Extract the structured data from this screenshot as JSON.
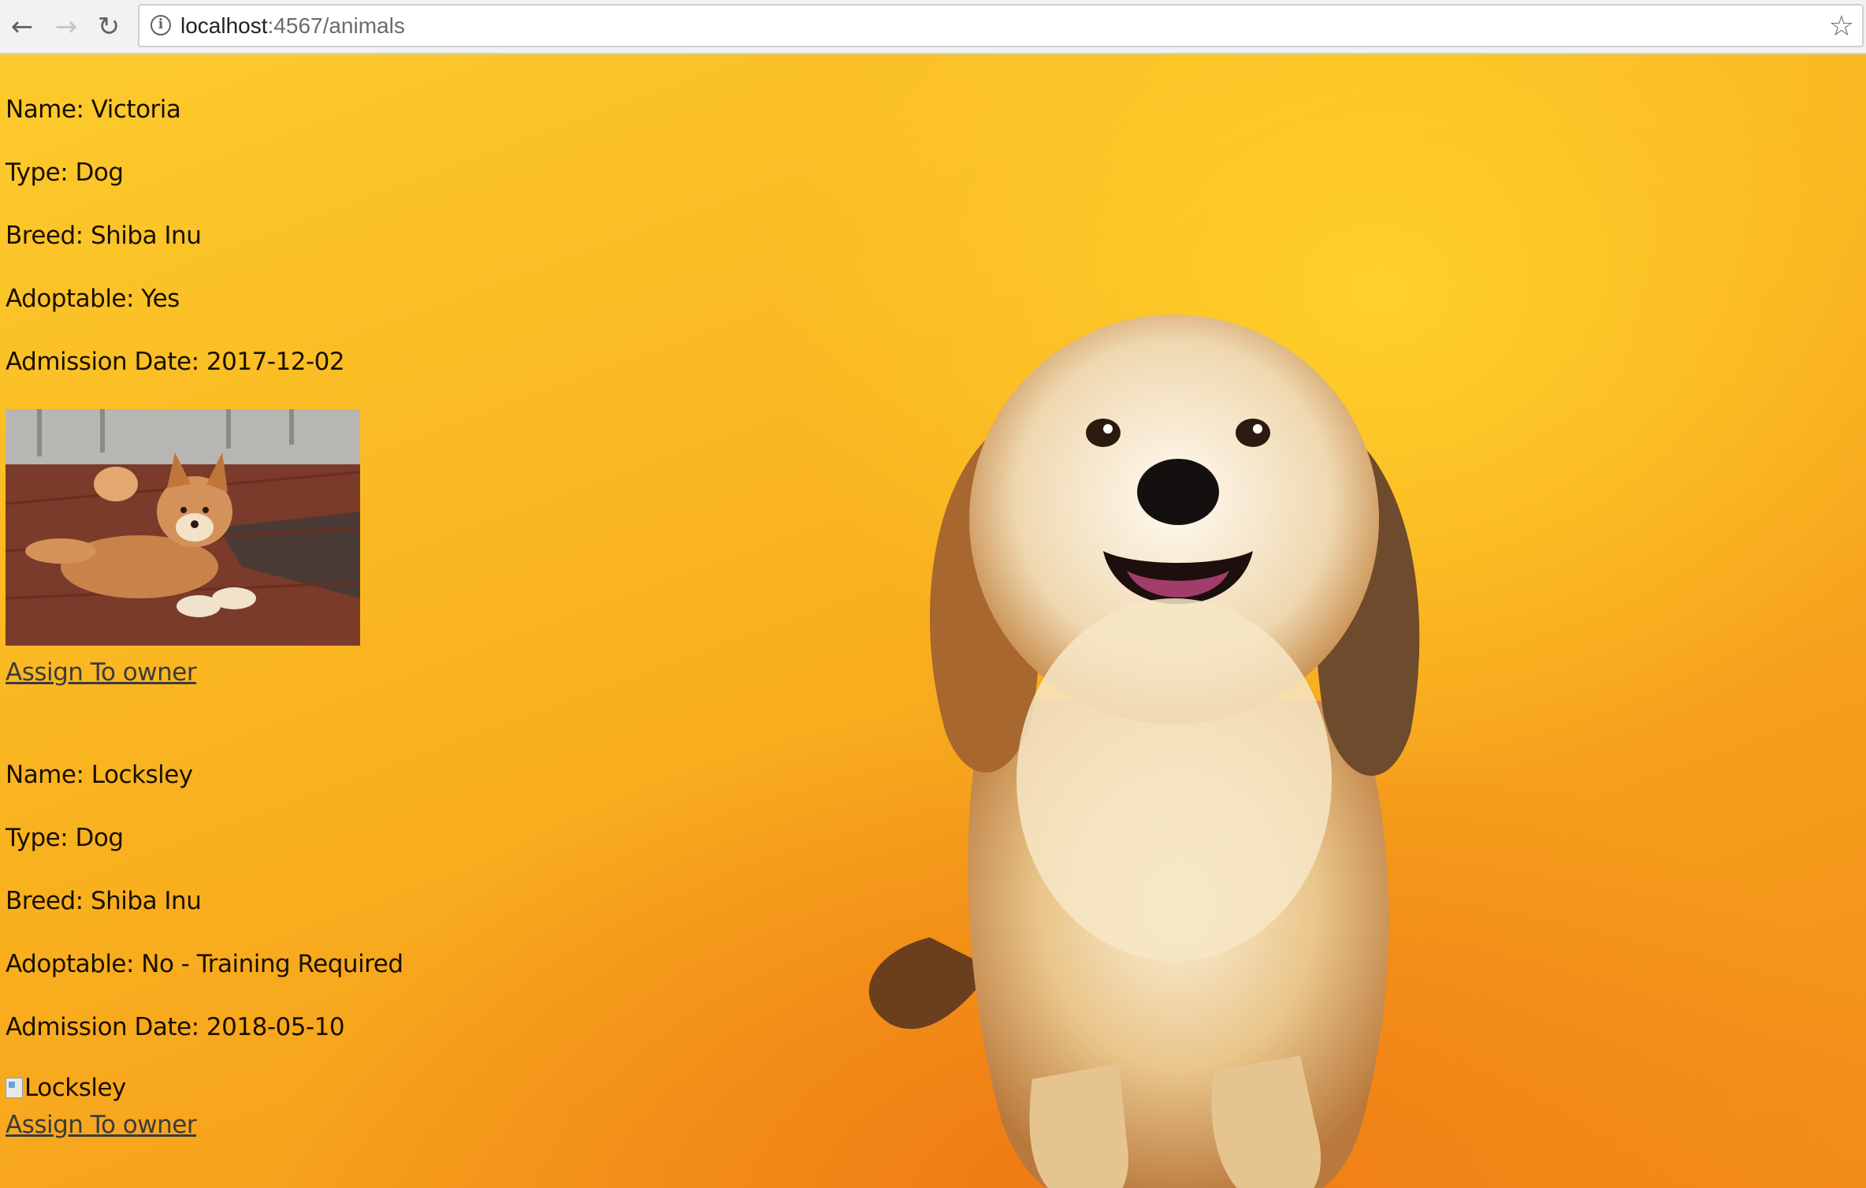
{
  "browser": {
    "url_host": "localhost",
    "url_rest": ":4567/animals",
    "back_icon": "←",
    "forward_icon": "→",
    "reload_icon": "↻",
    "info_icon": "i",
    "star_icon": "☆"
  },
  "animals": [
    {
      "name": "Name: Victoria",
      "type": "Type: Dog",
      "breed": "Breed: Shiba Inu",
      "adoptable": "Adoptable: Yes",
      "admission": "Admission Date: 2017-12-02",
      "assign_label": "Assign To owner"
    },
    {
      "name": "Name: Locksley",
      "type": "Type: Dog",
      "breed": "Breed: Shiba Inu",
      "adoptable": "Adoptable: No - Training Required",
      "admission": "Admission Date: 2018-05-10",
      "image_alt": "Locksley",
      "assign_label": "Assign To owner"
    }
  ],
  "colors": {
    "background_top": "#fccb2c",
    "background_bottom": "#f38c19",
    "text": "#1a1000",
    "link": "#3b3b3b"
  }
}
